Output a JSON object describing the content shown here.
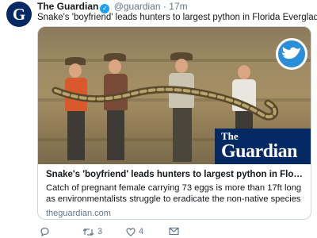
{
  "author": {
    "avatar_letter": "G",
    "name": "The Guardian",
    "handle": "@guardian",
    "separator": "·",
    "time": "17m"
  },
  "tweet": {
    "text": "Snake's 'boyfriend' leads hunters to largest python in Florida Everglades"
  },
  "card": {
    "title": "Snake's 'boyfriend' leads hunters to largest python in Florida Evergla...",
    "description": "Catch of pregnant female carrying 73 eggs is more than 17ft long as environmentalists struggle to eradicate the non-native species",
    "domain": "theguardian.com",
    "brand_the": "The",
    "brand_name": "Guardian"
  },
  "actions": {
    "retweet_count": "3",
    "like_count": "4"
  },
  "colors": {
    "guardian_blue": "#052962",
    "twitter_blue": "#1da1f2",
    "muted": "#657786"
  },
  "icons": [
    "verified-icon",
    "reply-icon",
    "retweet-icon",
    "like-icon",
    "message-icon",
    "bird-badge-icon"
  ]
}
